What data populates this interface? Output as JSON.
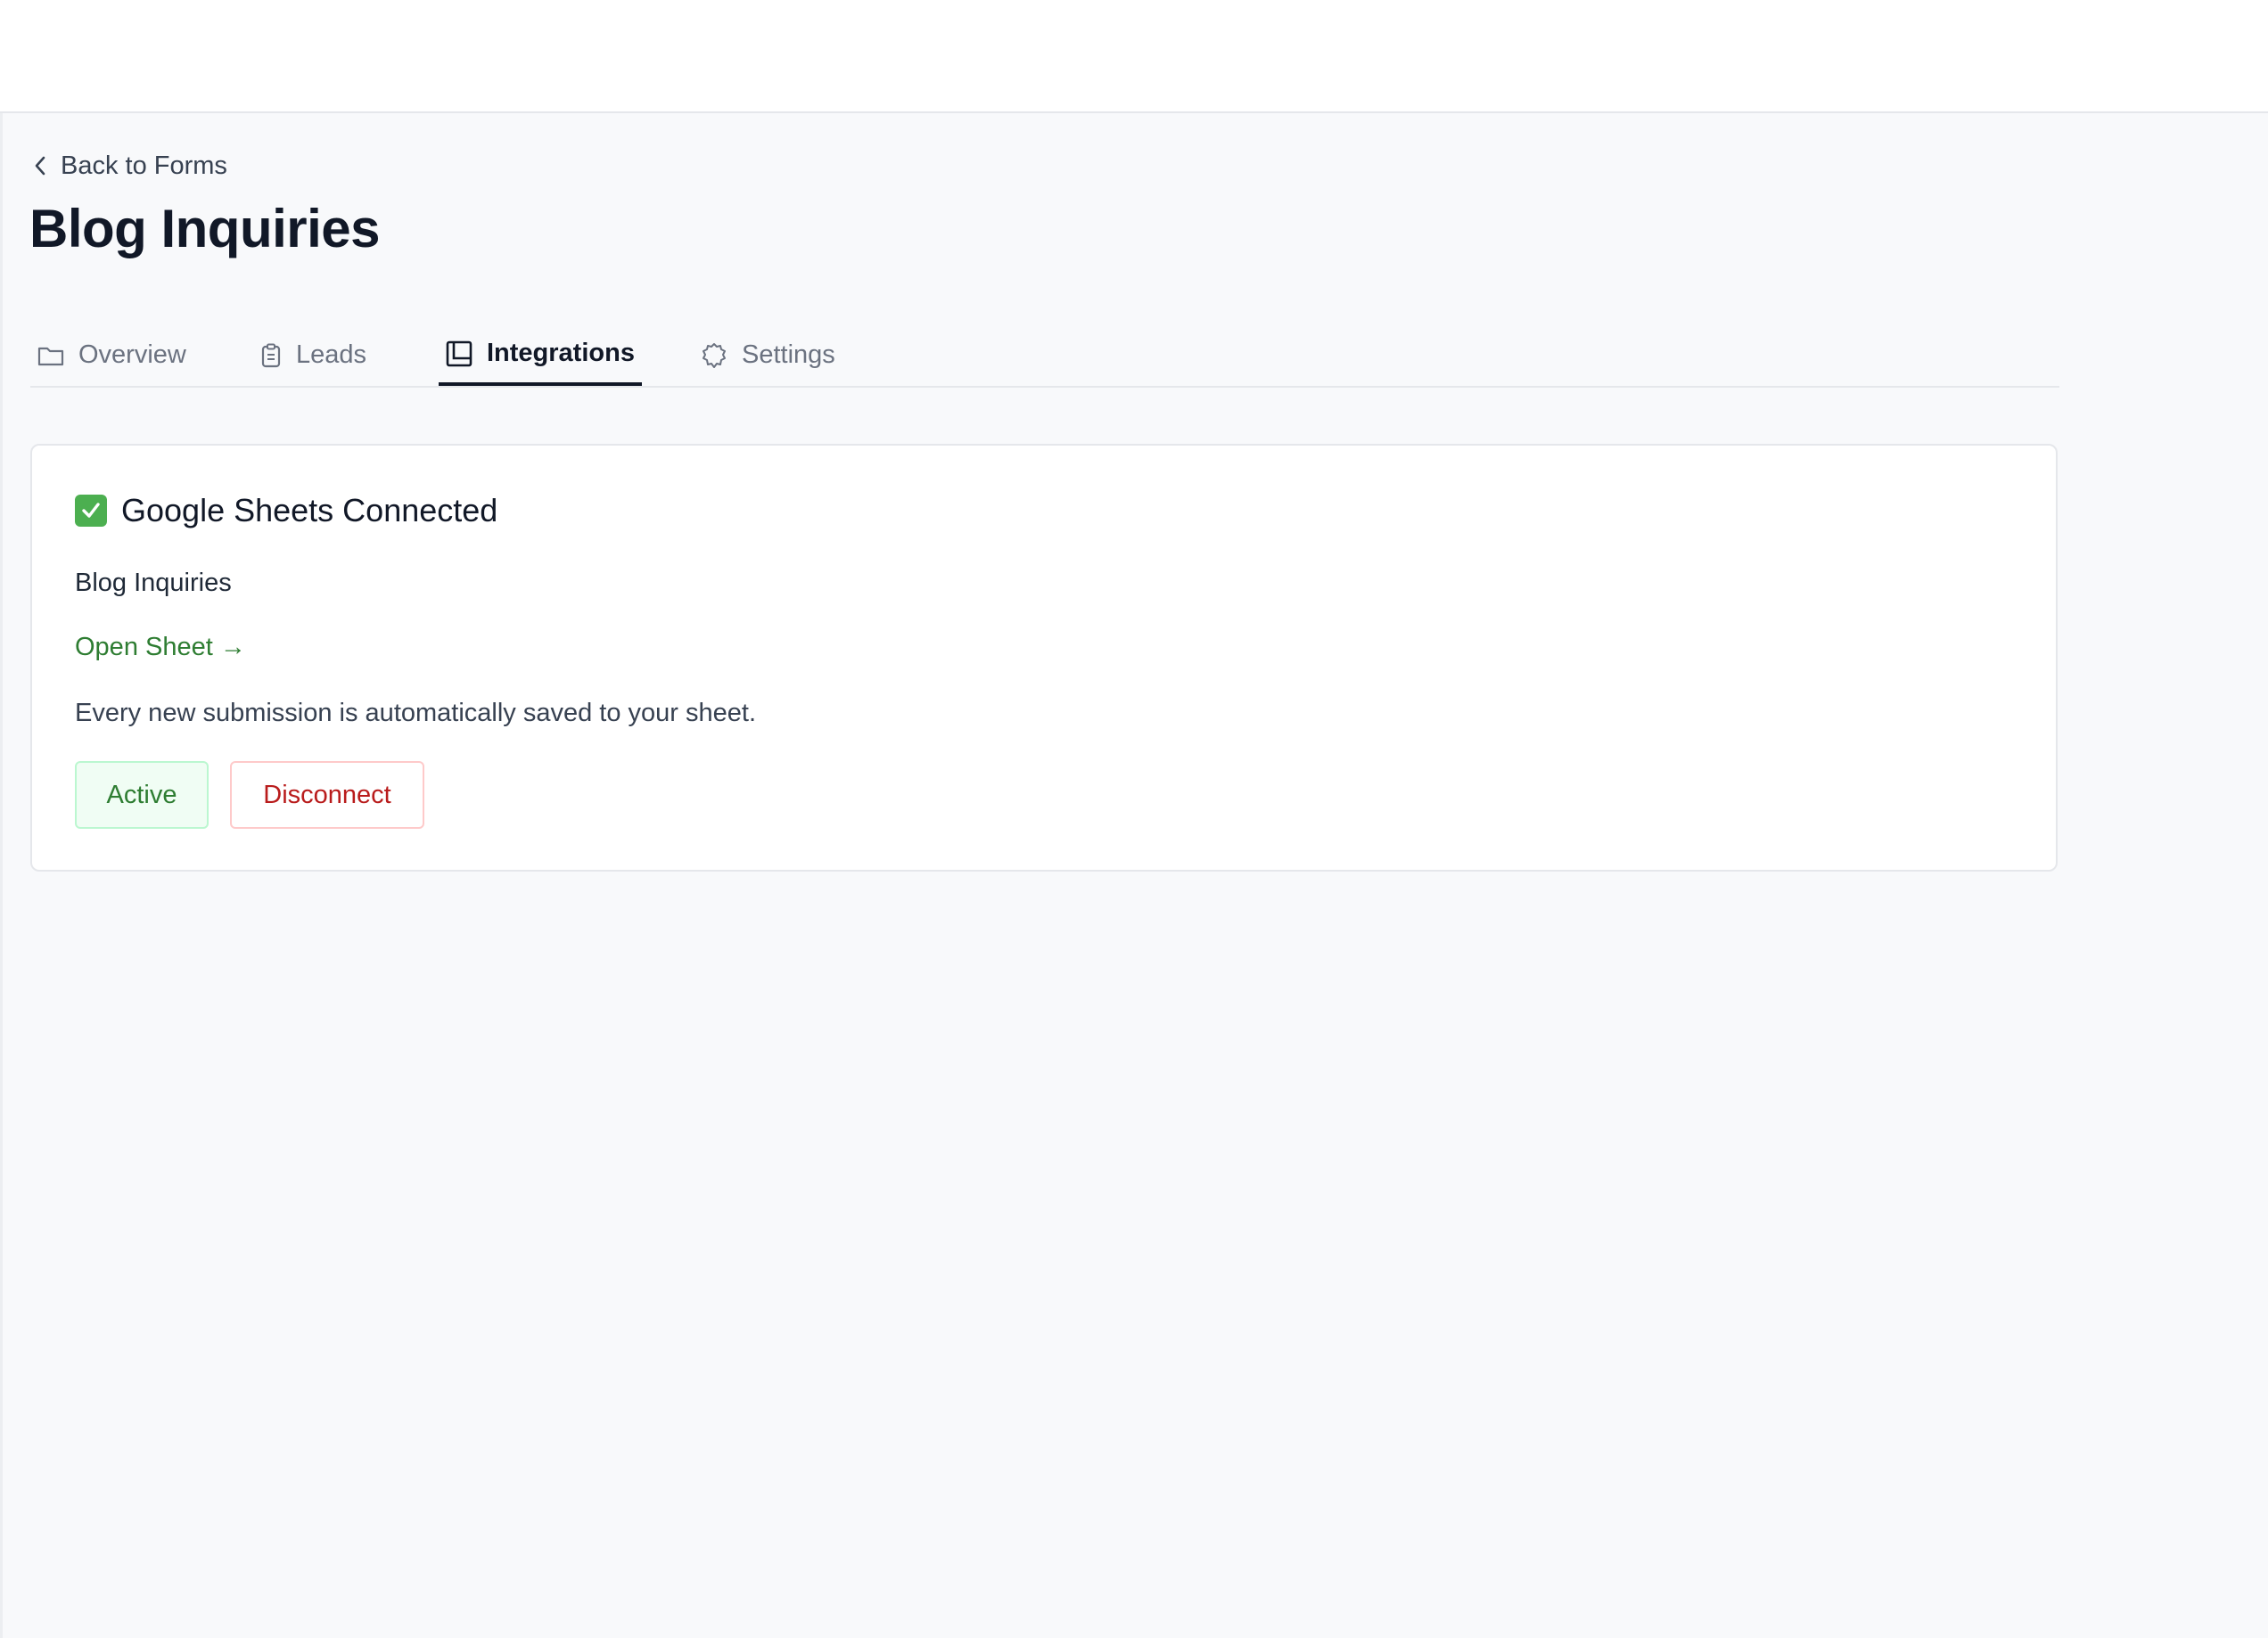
{
  "nav": {
    "back_label": "Back to Forms"
  },
  "page": {
    "title": "Blog Inquiries"
  },
  "tabs": [
    {
      "label": "Overview",
      "icon": "folder-icon",
      "active": false
    },
    {
      "label": "Leads",
      "icon": "clipboard-icon",
      "active": false
    },
    {
      "label": "Integrations",
      "icon": "layout-icon",
      "active": true
    },
    {
      "label": "Settings",
      "icon": "gear-icon",
      "active": false
    }
  ],
  "integration": {
    "status_emoji": "✅",
    "title": "Google Sheets Connected",
    "sheet_name": "Blog Inquiries",
    "open_link_label": "Open Sheet →",
    "description": "Every new submission is automatically saved to your sheet.",
    "active_label": "Active",
    "disconnect_label": "Disconnect"
  },
  "colors": {
    "accent_green": "#2e7d32",
    "danger_red": "#b91c1c",
    "active_tab": "#111827",
    "inactive_tab": "#6b7280"
  }
}
